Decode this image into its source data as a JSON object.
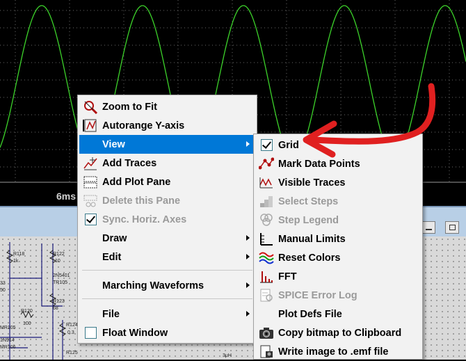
{
  "plot": {
    "time_label": "6ms",
    "trace_color": "#3cd22a",
    "grid_color": "#6a6a6a"
  },
  "main_menu": {
    "items": [
      {
        "label": "Zoom to Fit",
        "icon": "zoom-fit-icon",
        "enabled": true
      },
      {
        "label": "Autorange Y-axis",
        "icon": "autorange-icon",
        "enabled": true
      },
      {
        "label": "View",
        "icon": "",
        "enabled": true,
        "submenu": true,
        "highlighted": true
      },
      {
        "label": "Add Traces",
        "icon": "add-traces-icon",
        "enabled": true
      },
      {
        "label": "Add Plot Pane",
        "icon": "add-pane-icon",
        "enabled": true
      },
      {
        "label": "Delete this Pane",
        "icon": "delete-pane-icon",
        "enabled": false
      },
      {
        "label": "Sync. Horiz. Axes",
        "icon": "check-icon",
        "enabled": false,
        "checked": true
      },
      {
        "label": "Draw",
        "icon": "",
        "enabled": true,
        "submenu": true
      },
      {
        "label": "Edit",
        "icon": "",
        "enabled": true,
        "submenu": true
      },
      {
        "label": "Marching Waveforms",
        "icon": "",
        "enabled": true,
        "submenu": true
      },
      {
        "label": "File",
        "icon": "",
        "enabled": true,
        "submenu": true
      },
      {
        "label": "Float Window",
        "icon": "checkbox-icon",
        "enabled": true,
        "checked": false
      }
    ]
  },
  "view_menu": {
    "items": [
      {
        "label": "Grid",
        "icon": "check-icon",
        "enabled": true,
        "checked": true
      },
      {
        "label": "Mark Data Points",
        "icon": "data-points-icon",
        "enabled": true
      },
      {
        "label": "Visible Traces",
        "icon": "visible-traces-icon",
        "enabled": true
      },
      {
        "label": "Select Steps",
        "icon": "steps-icon",
        "enabled": false
      },
      {
        "label": "Step Legend",
        "icon": "legend-icon",
        "enabled": false
      },
      {
        "label": "Manual Limits",
        "icon": "manual-limits-icon",
        "enabled": true
      },
      {
        "label": "Reset Colors",
        "icon": "reset-colors-icon",
        "enabled": true
      },
      {
        "label": "FFT",
        "icon": "fft-icon",
        "enabled": true
      },
      {
        "label": "SPICE Error Log",
        "icon": "error-log-icon",
        "enabled": false
      },
      {
        "label": "Plot Defs File",
        "icon": "",
        "enabled": true
      },
      {
        "label": "Copy bitmap to Clipboard",
        "icon": "camera-icon",
        "enabled": true
      },
      {
        "label": "Write image to .emf file",
        "icon": "write-image-icon",
        "enabled": true
      }
    ]
  },
  "schematic": {
    "labels": [
      "R118",
      "1k",
      "R122",
      "10",
      "2N5401",
      "TR105",
      "R120",
      "100",
      "R123",
      "68",
      "R124",
      "0.3",
      "MR105",
      "1N914",
      "MR106",
      "R125",
      "3μH",
      "33",
      "50"
    ]
  },
  "colors": {
    "highlight": "#0078d7",
    "annotation": "#e02020"
  }
}
